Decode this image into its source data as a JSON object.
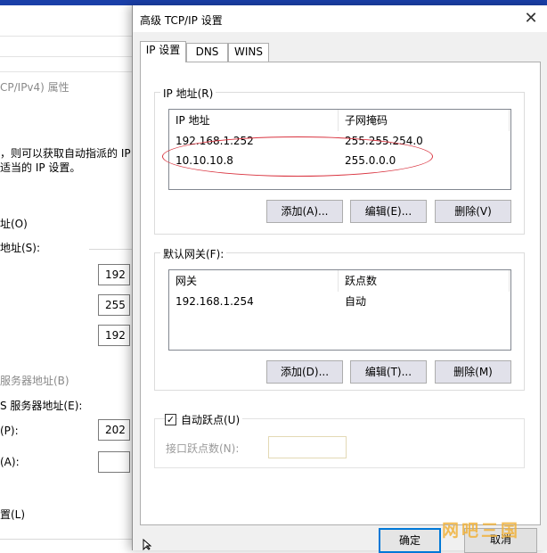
{
  "background_dialog": {
    "title_fragment": "CP/IPv4) 属性",
    "desc_line1": "，则可以获取自动指派的 IP",
    "desc_line2": "适当的 IP 设置。",
    "auto_ip": "址(O)",
    "use_ip": "地址(S):",
    "ip_parts": [
      "192",
      "255",
      "192"
    ],
    "auto_dns": "服务器地址(B)",
    "use_dns": "S 服务器地址(E):",
    "preferred_dns": "(P):",
    "preferred_dns_value": "202",
    "alternate_dns": "(A):",
    "advanced": "置(L)"
  },
  "dialog": {
    "title": "高级 TCP/IP 设置",
    "close_glyph": "✕",
    "tabs": [
      {
        "label": "IP 设置",
        "active": true
      },
      {
        "label": "DNS",
        "active": false
      },
      {
        "label": "WINS",
        "active": false
      }
    ],
    "ip_group": {
      "label": "IP 地址(R)",
      "columns": [
        "IP 地址",
        "子网掩码"
      ],
      "rows": [
        {
          "ip": "192.168.1.252",
          "mask": "255.255.254.0"
        },
        {
          "ip": "10.10.10.8",
          "mask": "255.0.0.0"
        }
      ],
      "buttons": [
        "添加(A)...",
        "编辑(E)...",
        "删除(V)"
      ]
    },
    "gateway_group": {
      "label": "默认网关(F):",
      "columns": [
        "网关",
        "跃点数"
      ],
      "rows": [
        {
          "gateway": "192.168.1.254",
          "metric": "自动"
        }
      ],
      "buttons": [
        "添加(D)...",
        "编辑(T)...",
        "删除(M)"
      ]
    },
    "metric_group": {
      "auto_metric_label": "自动跃点(U)",
      "auto_metric_checked": true,
      "check_glyph": "✓",
      "interface_metric_label": "接口跃点数(N):",
      "interface_metric_value": ""
    },
    "ok_label": "确定",
    "cancel_label": "取消"
  },
  "watermark": "网吧三国"
}
